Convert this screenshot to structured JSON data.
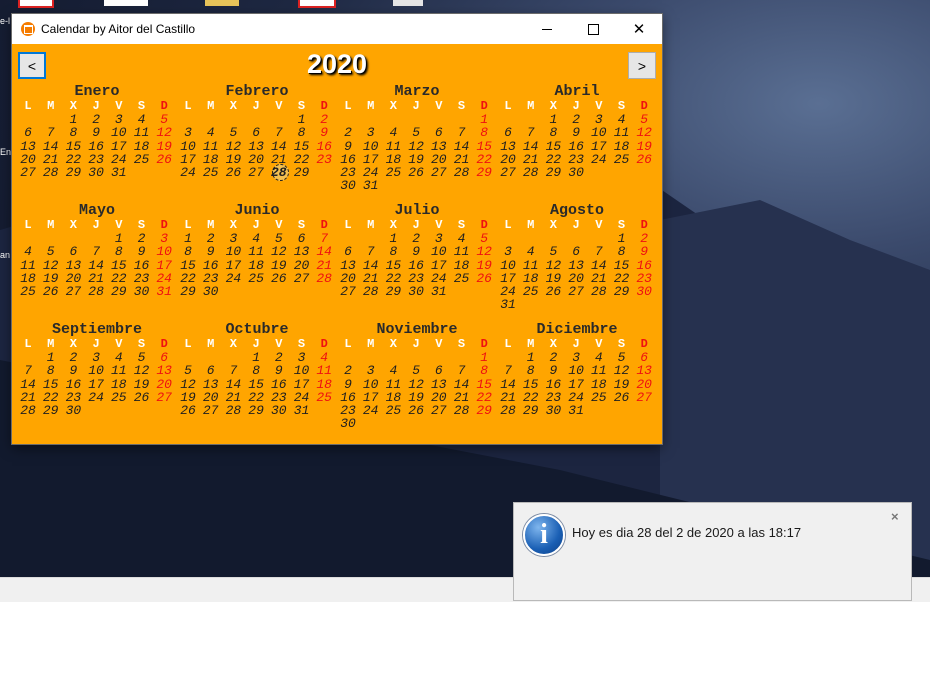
{
  "window": {
    "title": "Calendar by Aitor del Castillo",
    "year": "2020",
    "prev_label": "<",
    "next_label": ">",
    "minimize_icon": "minimize-icon",
    "maximize_icon": "maximize-icon",
    "close_label": "✕"
  },
  "weekday_headers": [
    "L",
    "M",
    "X",
    "J",
    "V",
    "S",
    "D"
  ],
  "colors": {
    "background": "#ffa500",
    "header_text": "#ffffff",
    "sunday": "#ee1111",
    "day_text": "#1f1f1f"
  },
  "today": {
    "month_index": 1,
    "day": 28
  },
  "months": [
    {
      "name": "Enero",
      "offset": 2,
      "days": 31
    },
    {
      "name": "Febrero",
      "offset": 5,
      "days": 29
    },
    {
      "name": "Marzo",
      "offset": 6,
      "days": 31
    },
    {
      "name": "Abril",
      "offset": 2,
      "days": 30
    },
    {
      "name": "Mayo",
      "offset": 4,
      "days": 31
    },
    {
      "name": "Junio",
      "offset": 0,
      "days": 30
    },
    {
      "name": "Julio",
      "offset": 2,
      "days": 31
    },
    {
      "name": "Agosto",
      "offset": 5,
      "days": 31
    },
    {
      "name": "Septiembre",
      "offset": 1,
      "days": 30
    },
    {
      "name": "Octubre",
      "offset": 3,
      "days": 31
    },
    {
      "name": "Noviembre",
      "offset": 6,
      "days": 30
    },
    {
      "name": "Diciembre",
      "offset": 1,
      "days": 31
    }
  ],
  "notification": {
    "icon": "info-icon",
    "icon_glyph": "i",
    "message": "Hoy es dia 28 del 2 de 2020 a las 18:17",
    "close_label": "×"
  },
  "desktop": {
    "left_text_1": "e-l",
    "left_text_2": "En",
    "left_text_3": "an"
  }
}
